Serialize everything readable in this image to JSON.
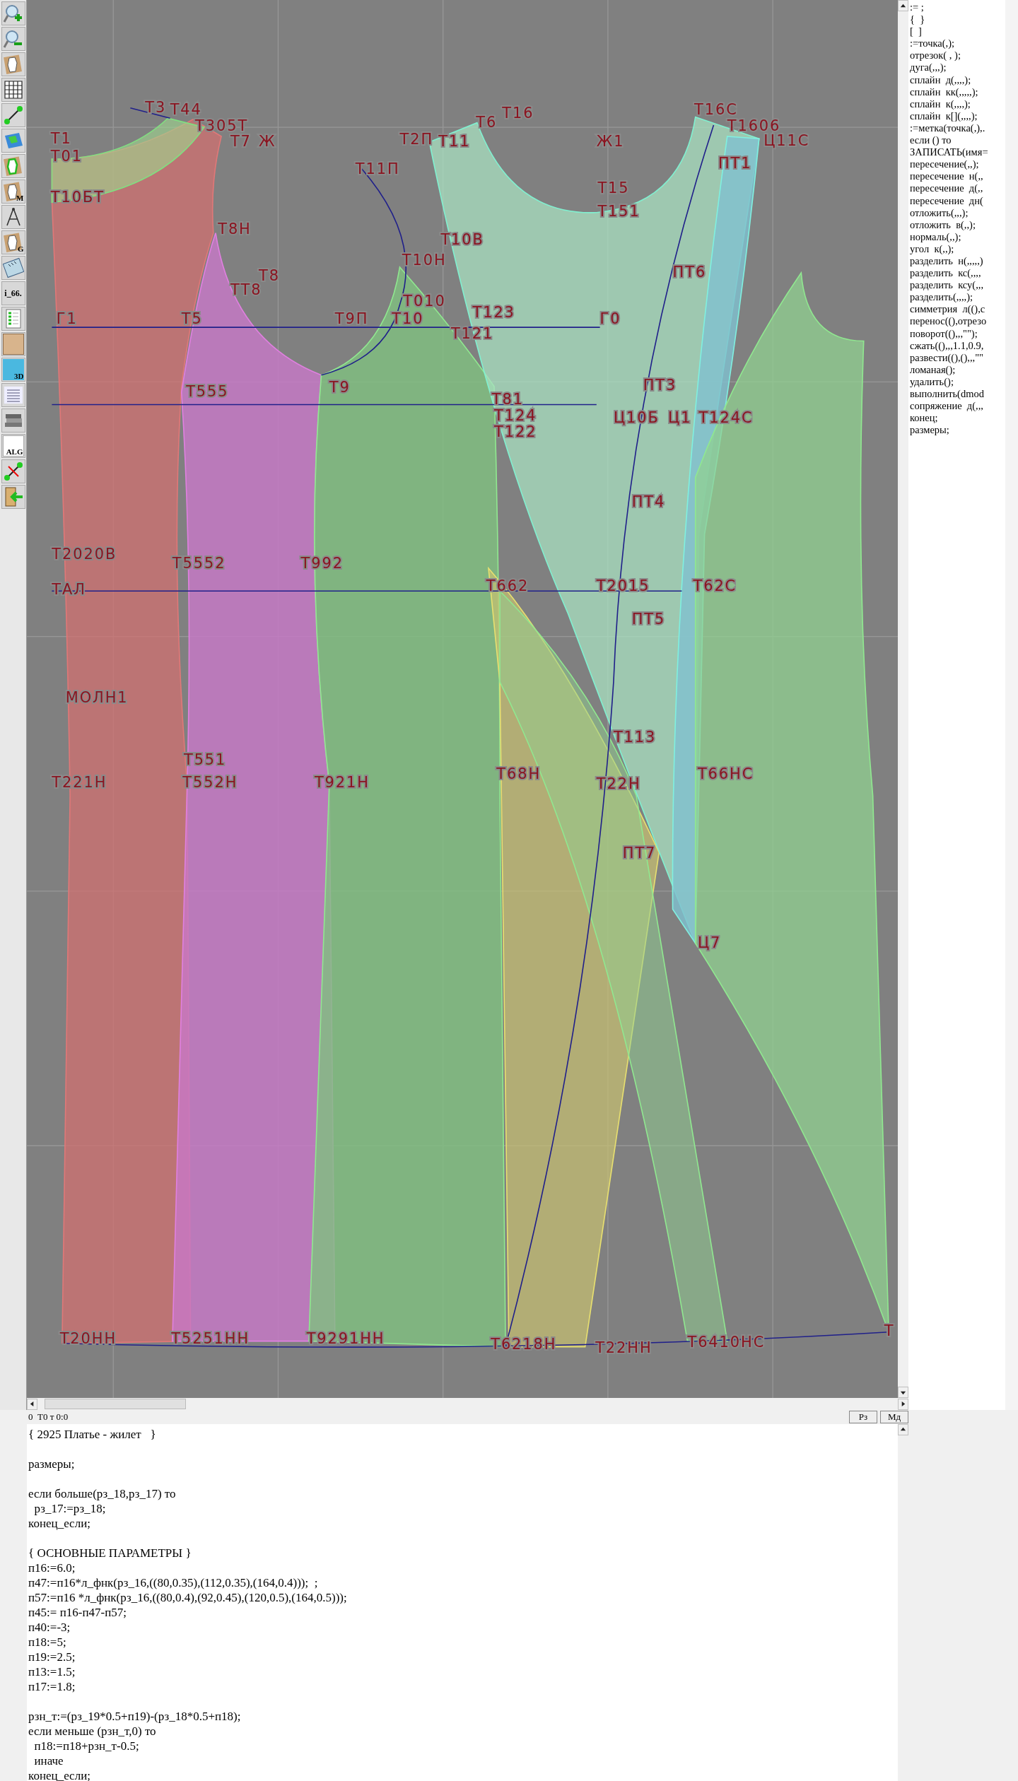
{
  "toolbar": [
    {
      "kind": "zoom-in"
    },
    {
      "kind": "zoom-out"
    },
    {
      "kind": "pattern-sheet"
    },
    {
      "kind": "grid"
    },
    {
      "kind": "segment"
    },
    {
      "kind": "map"
    },
    {
      "kind": "pattern-outline"
    },
    {
      "kind": "pattern-letter",
      "label": "M"
    },
    {
      "kind": "compass"
    },
    {
      "kind": "pattern-letter",
      "label": "G"
    },
    {
      "kind": "ruler"
    },
    {
      "kind": "text",
      "label": "i_66."
    },
    {
      "kind": "table"
    },
    {
      "kind": "photo"
    },
    {
      "kind": "cubes",
      "label": "3D"
    },
    {
      "kind": "list"
    },
    {
      "kind": "books"
    },
    {
      "kind": "document",
      "label": "ALG"
    },
    {
      "kind": "cross-segment"
    },
    {
      "kind": "exit"
    }
  ],
  "canvas": {
    "labels": [
      "Т1",
      "Т01",
      "Т10БТ",
      "Т3",
      "Т44",
      "Т305Т",
      "Т7",
      "Ж",
      "Т11П",
      "Т2П",
      "Т11",
      "Т6",
      "Т16",
      "Ж1",
      "Т16С",
      "Т1606",
      "Ц11С",
      "ПТ1",
      "Т15",
      "Т151",
      "Т10В",
      "Т8Н",
      "Т10Н",
      "Т8",
      "ТТ8",
      "ПТ6",
      "Т010",
      "Г1",
      "Т5",
      "Т9П",
      "Т10",
      "Т123",
      "Т121",
      "Г0",
      "Т9",
      "ПТ3",
      "Т555",
      "Т81",
      "Т124",
      "Т122",
      "Ц10Б",
      "Ц1",
      "Т124С",
      "ПТ4",
      "Т2020В",
      "Т5552",
      "Т992",
      "ТАЛ",
      "Т662",
      "Т2015",
      "Т62С",
      "ПТ5",
      "МОЛН1",
      "Т113",
      "Т551",
      "Т221Н",
      "Т552Н",
      "Т921Н",
      "Т68Н",
      "Т22Н",
      "Т66НС",
      "ПТ7",
      "Ц7",
      "Т20НН",
      "Т5251НН",
      "Т9291НН",
      "Т6218Н",
      "Т22НН",
      "Т6410НС",
      "Т"
    ]
  },
  "command_list": [
    ":= ;",
    "{  }",
    "[  ]",
    ":=точка(,);",
    "отрезок( , );",
    "дуга(,,,);",
    "сплайн  д(,,,,);",
    "сплайн  кк(,,,,,);",
    "сплайн  к(,,,,);",
    "сплайн  к[](,,,,);",
    ":=метка(точка(,),.",
    "если () то",
    "ЗАПИСАТЬ(имя=",
    "пересечение(,,);",
    "пересечение  н(,,",
    "пересечение  д(,,",
    "пересечение  дн(",
    "отложить(,,,);",
    "отложить  в(,,);",
    "нормаль(,,);",
    "угол  к(,,);",
    "разделить  н(,,,,,)",
    "разделить  кс(,,,,",
    "разделить  ксу(,,,",
    "разделить(,,,,);",
    "симметрия  л((),с",
    "перенос((),отрезо",
    "поворот((),,,\"\");",
    "сжать((),,,1.1,0.9,",
    "развести((),(),,,\"\"",
    "ломаная();",
    "удалить();",
    "выполнить(dmod",
    "сопряжение  д(,,,",
    "конец;",
    "размеры;"
  ],
  "status_bar": {
    "text": "0  Т0 т 0:0",
    "buttons": [
      "Рз",
      "Мд"
    ]
  },
  "editor": {
    "paragraphs": [
      [
        "{ 2925 Платье - жилет   }"
      ],
      [
        "размеры;"
      ],
      [
        "если больше(рз_18,рз_17) то",
        "  рз_17:=рз_18;",
        "конец_если;"
      ],
      [
        "{ ОСНОВНЫЕ ПАРАМЕТРЫ }",
        "п16:=6.0;",
        "п47:=п16*л_фнк(рз_16,((80,0.35),(112,0.35),(164,0.4)));  ;",
        "п57:=п16 *л_фнк(рз_16,((80,0.4),(92,0.45),(120,0.5),(164,0.5)));",
        "п45:= п16-п47-п57;",
        "п40:=-3;",
        "п18:=5;",
        "п19:=2.5;",
        "п13:=1.5;",
        "п17:=1.8;"
      ],
      [
        "рзн_т:=(рз_19*0.5+п19)-(рз_18*0.5+п18);",
        "если меньше (рзн_т,0) то",
        "  п18:=п18+рзн_т-0.5;",
        "  иначе",
        "конец_если;"
      ]
    ]
  }
}
